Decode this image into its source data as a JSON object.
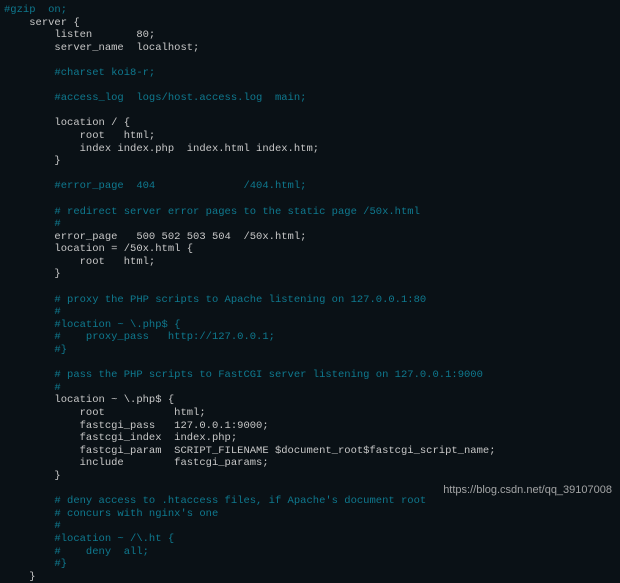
{
  "watermark": "https://blog.csdn.net/qq_39107008",
  "lines": [
    {
      "indent": 0,
      "segs": [
        {
          "cls": "c",
          "t": "#gzip  on;"
        }
      ]
    },
    {
      "indent": 1,
      "segs": [
        {
          "cls": "d",
          "t": "server {"
        }
      ]
    },
    {
      "indent": 2,
      "segs": [
        {
          "cls": "d",
          "t": "listen       80;"
        }
      ]
    },
    {
      "indent": 2,
      "segs": [
        {
          "cls": "d",
          "t": "server_name  localhost;"
        }
      ]
    },
    {
      "indent": 0,
      "segs": [
        {
          "cls": "d",
          "t": ""
        }
      ]
    },
    {
      "indent": 2,
      "segs": [
        {
          "cls": "c",
          "t": "#charset koi8-r;"
        }
      ]
    },
    {
      "indent": 0,
      "segs": [
        {
          "cls": "d",
          "t": ""
        }
      ]
    },
    {
      "indent": 2,
      "segs": [
        {
          "cls": "c",
          "t": "#access_log  logs/host.access.log  main;"
        }
      ]
    },
    {
      "indent": 0,
      "segs": [
        {
          "cls": "d",
          "t": ""
        }
      ]
    },
    {
      "indent": 2,
      "segs": [
        {
          "cls": "d",
          "t": "location / {"
        }
      ]
    },
    {
      "indent": 3,
      "segs": [
        {
          "cls": "d",
          "t": "root   html;"
        }
      ]
    },
    {
      "indent": 3,
      "segs": [
        {
          "cls": "d",
          "t": "index index.php  index.html index.htm;"
        }
      ]
    },
    {
      "indent": 2,
      "segs": [
        {
          "cls": "d",
          "t": "}"
        }
      ]
    },
    {
      "indent": 0,
      "segs": [
        {
          "cls": "d",
          "t": ""
        }
      ]
    },
    {
      "indent": 2,
      "segs": [
        {
          "cls": "c",
          "t": "#error_page  404              /404.html;"
        }
      ]
    },
    {
      "indent": 0,
      "segs": [
        {
          "cls": "d",
          "t": ""
        }
      ]
    },
    {
      "indent": 2,
      "segs": [
        {
          "cls": "c",
          "t": "# redirect server error pages to the static page /50x.html"
        }
      ]
    },
    {
      "indent": 2,
      "segs": [
        {
          "cls": "c",
          "t": "#"
        }
      ]
    },
    {
      "indent": 2,
      "segs": [
        {
          "cls": "d",
          "t": "error_page   500 502 503 504  /50x.html;"
        }
      ]
    },
    {
      "indent": 2,
      "segs": [
        {
          "cls": "d",
          "t": "location = /50x.html {"
        }
      ]
    },
    {
      "indent": 3,
      "segs": [
        {
          "cls": "d",
          "t": "root   html;"
        }
      ]
    },
    {
      "indent": 2,
      "segs": [
        {
          "cls": "d",
          "t": "}"
        }
      ]
    },
    {
      "indent": 0,
      "segs": [
        {
          "cls": "d",
          "t": ""
        }
      ]
    },
    {
      "indent": 2,
      "segs": [
        {
          "cls": "c",
          "t": "# proxy the PHP scripts to Apache listening on 127.0.0.1:80"
        }
      ]
    },
    {
      "indent": 2,
      "segs": [
        {
          "cls": "c",
          "t": "#"
        }
      ]
    },
    {
      "indent": 2,
      "segs": [
        {
          "cls": "c",
          "t": "#location ~ \\.php$ {"
        }
      ]
    },
    {
      "indent": 2,
      "segs": [
        {
          "cls": "c",
          "t": "#    proxy_pass   http://127.0.0.1;"
        }
      ]
    },
    {
      "indent": 2,
      "segs": [
        {
          "cls": "c",
          "t": "#}"
        }
      ]
    },
    {
      "indent": 0,
      "segs": [
        {
          "cls": "d",
          "t": ""
        }
      ]
    },
    {
      "indent": 2,
      "segs": [
        {
          "cls": "c",
          "t": "# pass the PHP scripts to FastCGI server listening on 127.0.0.1:9000"
        }
      ]
    },
    {
      "indent": 2,
      "segs": [
        {
          "cls": "c",
          "t": "#"
        }
      ]
    },
    {
      "indent": 2,
      "segs": [
        {
          "cls": "d",
          "t": "location ~ \\.php$ {"
        }
      ]
    },
    {
      "indent": 3,
      "segs": [
        {
          "cls": "d",
          "t": "root           html;"
        }
      ]
    },
    {
      "indent": 3,
      "segs": [
        {
          "cls": "d",
          "t": "fastcgi_pass   127.0.0.1:9000;"
        }
      ]
    },
    {
      "indent": 3,
      "segs": [
        {
          "cls": "d",
          "t": "fastcgi_index  index.php;"
        }
      ]
    },
    {
      "indent": 3,
      "segs": [
        {
          "cls": "d",
          "t": "fastcgi_param  SCRIPT_FILENAME $document_root$fastcgi_script_name;"
        }
      ]
    },
    {
      "indent": 3,
      "segs": [
        {
          "cls": "d",
          "t": "include        fastcgi_params;"
        }
      ]
    },
    {
      "indent": 2,
      "segs": [
        {
          "cls": "d",
          "t": "}"
        }
      ]
    },
    {
      "indent": 0,
      "segs": [
        {
          "cls": "d",
          "t": ""
        }
      ]
    },
    {
      "indent": 2,
      "segs": [
        {
          "cls": "c",
          "t": "# deny access to .htaccess files, if Apache's document root"
        }
      ]
    },
    {
      "indent": 2,
      "segs": [
        {
          "cls": "c",
          "t": "# concurs with nginx's one"
        }
      ]
    },
    {
      "indent": 2,
      "segs": [
        {
          "cls": "c",
          "t": "#"
        }
      ]
    },
    {
      "indent": 2,
      "segs": [
        {
          "cls": "c",
          "t": "#location ~ /\\.ht {"
        }
      ]
    },
    {
      "indent": 2,
      "segs": [
        {
          "cls": "c",
          "t": "#    deny  all;"
        }
      ]
    },
    {
      "indent": 2,
      "segs": [
        {
          "cls": "c",
          "t": "#}"
        }
      ]
    },
    {
      "indent": 1,
      "segs": [
        {
          "cls": "d",
          "t": "}"
        }
      ]
    }
  ]
}
